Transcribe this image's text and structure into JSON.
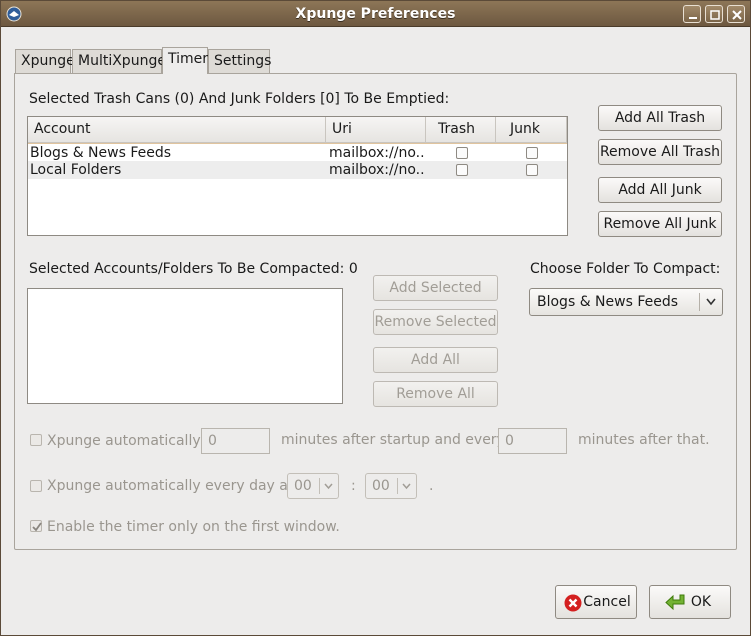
{
  "window": {
    "title": "Xpunge Preferences",
    "app_icon": "thunderbird-icon",
    "controls": [
      "minimize-icon",
      "maximize-icon",
      "close-icon"
    ]
  },
  "tabs": [
    {
      "label": "Xpunge",
      "active": false
    },
    {
      "label": "MultiXpunge",
      "active": false
    },
    {
      "label": "Timer",
      "active": true
    },
    {
      "label": "Settings",
      "active": false
    }
  ],
  "empty_section": {
    "heading": "Selected Trash Cans (0) And Junk Folders [0] To Be Emptied:",
    "columns": [
      "Account",
      "Uri",
      "Trash",
      "Junk"
    ],
    "rows": [
      {
        "account": "Blogs & News Feeds",
        "uri": "mailbox://no...",
        "trash": false,
        "junk": false
      },
      {
        "account": "Local Folders",
        "uri": "mailbox://no...",
        "trash": false,
        "junk": false
      }
    ],
    "buttons": {
      "add_all_trash": "Add All Trash",
      "remove_all_trash": "Remove All Trash",
      "add_all_junk": "Add All Junk",
      "remove_all_junk": "Remove All Junk"
    }
  },
  "compact_section": {
    "heading": "Selected Accounts/Folders To Be Compacted: 0",
    "buttons": {
      "add_selected": "Add Selected",
      "remove_selected": "Remove Selected",
      "add_all": "Add All",
      "remove_all": "Remove All"
    },
    "choose_label": "Choose Folder To Compact:",
    "choose_value": "Blogs & News Feeds"
  },
  "timer": {
    "auto_label": "Xpunge automatically",
    "startup_minutes": "0",
    "between_label": "minutes after startup and every",
    "every_minutes": "0",
    "after_label": "minutes after that.",
    "daily_label": "Xpunge automatically every day at",
    "hour": "00",
    "colon": ":",
    "minute": "00",
    "period": ".",
    "first_window_label": "Enable the timer only on the first window.",
    "first_window_checked": true,
    "auto_checked": false,
    "daily_checked": false
  },
  "footer": {
    "cancel": "Cancel",
    "ok": "OK"
  },
  "colors": {
    "titlebar": "#7b6549",
    "window_bg": "#edeceb",
    "cancel_icon": "#d42020",
    "ok_icon": "#4e9a06"
  }
}
